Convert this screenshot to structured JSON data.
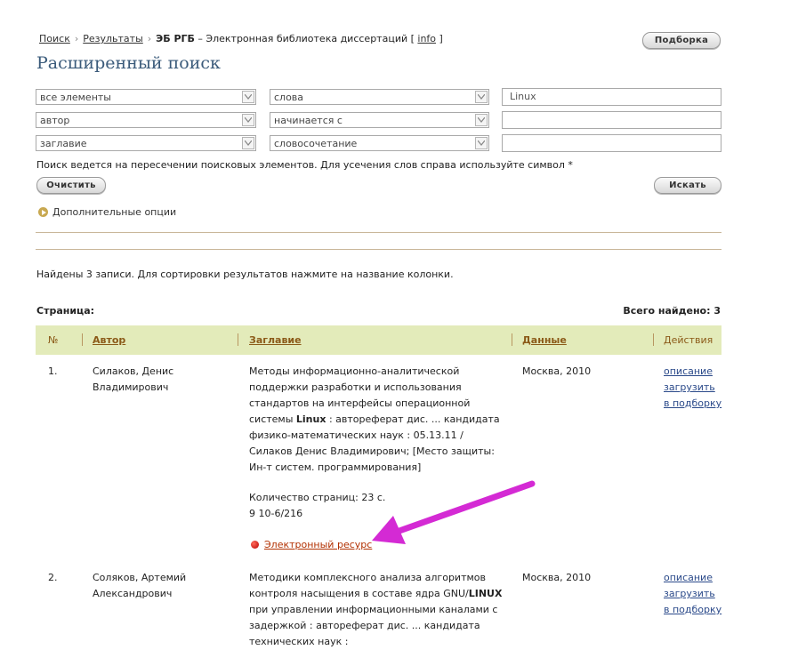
{
  "breadcrumb": {
    "search": "Поиск",
    "results": "Результаты",
    "current": "ЭБ РГБ",
    "current_desc": " – Электронная библиотека диссертаций  [",
    "info": "info",
    "close_bracket": "]"
  },
  "selection_button": "Подборка",
  "page_title": "Расширенный поиск",
  "search_rows": [
    {
      "field": "все элементы",
      "mode": "слова",
      "value": "Linux"
    },
    {
      "field": "автор",
      "mode": "начинается с",
      "value": ""
    },
    {
      "field": "заглавие",
      "mode": "словосочетание",
      "value": ""
    }
  ],
  "hint": "Поиск ведется на пересечении поисковых элементов. Для усечения слов справа используйте символ *",
  "clear_button": "Очистить",
  "search_button": "Искать",
  "more_options": "Дополнительные опции",
  "found_text": "Найдены 3 записи. Для сортировки результатов нажмите на название колонки.",
  "page_label": "Страница:",
  "total_found": "Всего найдено: 3",
  "columns": {
    "num": "№",
    "author": "Автор",
    "title": "Заглавие",
    "data": "Данные",
    "actions": "Действия"
  },
  "results": [
    {
      "num": "1.",
      "author": "Силаков, Денис Владимирович",
      "title_before": "Методы информационно-аналитической поддержки разработки и использования стандартов на интерфейсы операционной системы ",
      "title_bold": "Linux",
      "title_after": " : автореферат дис. ... кандидата физико-математических наук : 05.13.11 / Силаков Денис Владимирович; [Место защиты: Ин-т систем. программирования]",
      "pages": "Количество страниц: 23 с.",
      "code": "9 10-6/216",
      "resource": "Электронный ресурс",
      "data": "Москва, 2010",
      "actions": [
        "описание",
        "загрузить",
        "в подборку"
      ]
    },
    {
      "num": "2.",
      "author": "Соляков, Артемий Александрович",
      "title_before": "Методики комплексного анализа алгоритмов контроля насыщения в составе ядра GNU/",
      "title_bold": "LINUX",
      "title_after": " при управлении информационными каналами с задержкой : автореферат дис. ... кандидата технических наук :",
      "data": "Москва, 2010",
      "actions": [
        "описание",
        "загрузить",
        "в подборку"
      ]
    }
  ],
  "colors": {
    "accent_arrow": "#d42ad4",
    "table_header": "#e3ebba",
    "link": "#2b4a8a",
    "title": "#3a5a7a"
  }
}
